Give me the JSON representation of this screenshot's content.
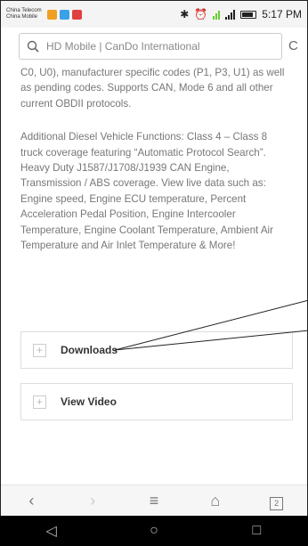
{
  "status_bar": {
    "carrier1": "China Telecom",
    "carrier2": "China Mobile",
    "time": "5:17 PM",
    "notif_colors": [
      "#f0a020",
      "#3aa0e8",
      "#e04040"
    ]
  },
  "url_bar": {
    "search_icon": "search-icon",
    "text": "HD Mobile | CanDo International",
    "reload_icon": "reload-icon"
  },
  "content": {
    "para1": "C0, U0), manufacturer specific codes (P1, P3, U1) as well as pending codes. Supports CAN, Mode 6 and all other current OBDII protocols.",
    "para2": "Additional Diesel Vehicle Functions: Class 4 – Class 8 truck coverage featuring “Automatic Protocol Search”. Heavy Duty J1587/J1708/J1939 CAN Engine, Transmission / ABS coverage. View live data such as: Engine speed, Engine ECU temperature, Percent Acceleration Pedal Position, Engine Intercooler Temperature, Engine Coolant Temperature, Ambient Air Temperature and Air Inlet Temperature & More!"
  },
  "accordions": [
    {
      "label": "Downloads",
      "icon": "plus"
    },
    {
      "label": "View Video",
      "icon": "plus"
    }
  ],
  "browser_toolbar": {
    "back": "‹",
    "forward": "›",
    "menu": "≡",
    "home": "⌂",
    "tabs": "2"
  },
  "android_nav": {
    "back": "◁",
    "home": "○",
    "recent": "□"
  }
}
